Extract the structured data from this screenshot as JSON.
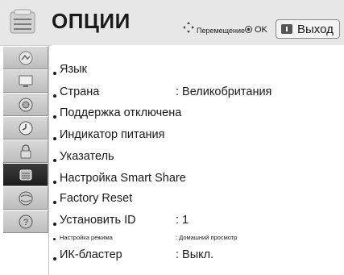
{
  "header": {
    "title": "ОПЦИИ",
    "hint_move": "Перемещение",
    "hint_ok": "OK",
    "exit_label": "Выход"
  },
  "sidebar": {
    "items": [
      {
        "icon": "picture-icon"
      },
      {
        "icon": "screen-icon"
      },
      {
        "icon": "audio-icon"
      },
      {
        "icon": "clock-icon"
      },
      {
        "icon": "lock-icon"
      },
      {
        "icon": "options-icon",
        "selected": true
      },
      {
        "icon": "network-icon"
      },
      {
        "icon": "help-icon"
      }
    ]
  },
  "menu": {
    "items": [
      {
        "label": "Язык",
        "value": ""
      },
      {
        "label": "Страна",
        "value": ": Великобритания"
      },
      {
        "label": "Поддержка отключена",
        "value": ""
      },
      {
        "label": "Индикатор питания",
        "value": ""
      },
      {
        "label": "Указатель",
        "value": ""
      },
      {
        "label": "Настройка Smart Share",
        "value": ""
      },
      {
        "label": "Factory Reset",
        "value": ""
      },
      {
        "label": "Установить ID",
        "value": ": 1"
      },
      {
        "label": "Настройка режима",
        "value": ": Домашний просмотр",
        "small": true
      },
      {
        "label": "ИК-бластер",
        "value": ": Выкл."
      }
    ]
  },
  "colors": {
    "header_bg": "#e7e7e7",
    "sidebar_item": "#cfcfcf",
    "sidebar_selected": "#2a2a2a",
    "text": "#1a1a1a"
  }
}
